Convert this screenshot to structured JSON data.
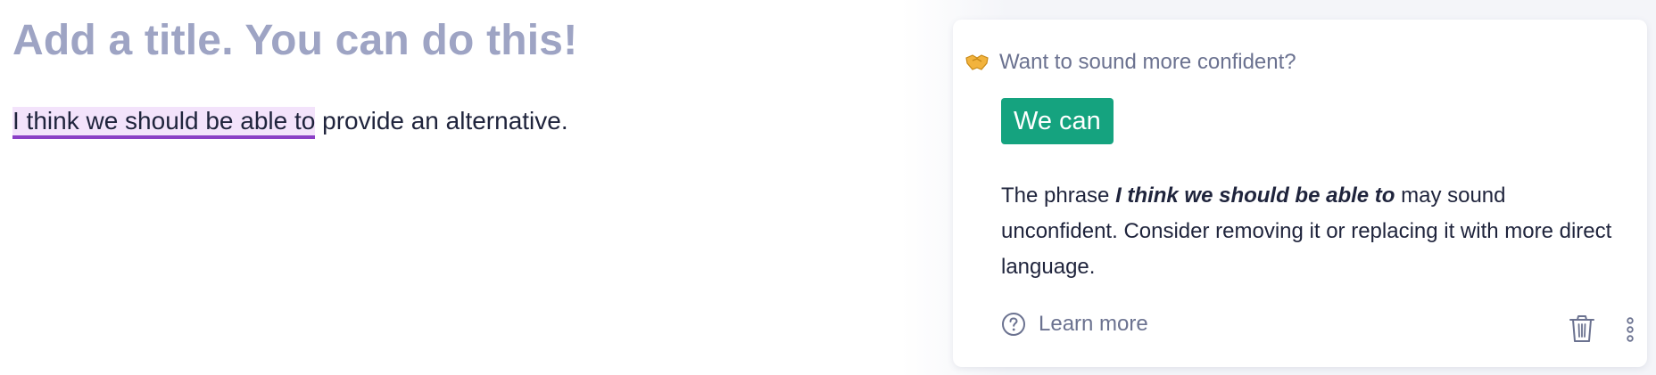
{
  "editor": {
    "title_placeholder": "Add a title. You can do this!",
    "body": {
      "highlighted_phrase": "I think we should be able to",
      "rest": " provide an alternative."
    }
  },
  "suggestion_card": {
    "header_icon": "handshake-icon",
    "header": "Want to sound more confident?",
    "replacement": "We can",
    "explanation": {
      "prefix": "The phrase ",
      "phrase": "I think we should be able to",
      "suffix": " may sound unconfident. Consider removing it or replacing it with more direct language."
    },
    "learn_more_icon": "help-circle-icon",
    "learn_more": "Learn more",
    "actions": [
      "trash-icon",
      "more-options-icon"
    ]
  },
  "colors": {
    "title_placeholder": "#9ea4c4",
    "highlight_underline": "#8b3fc6",
    "highlight_background": "#f3e3fb",
    "accept_button": "#15a37f",
    "muted_text": "#6b7290",
    "body_text": "#1f243c"
  }
}
